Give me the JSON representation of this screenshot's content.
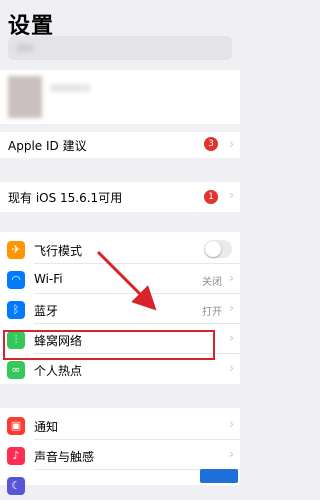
{
  "header": {
    "title": "设置"
  },
  "profile": {},
  "apple_id": {
    "label": "Apple ID 建议",
    "badge": "3"
  },
  "update": {
    "label": "现有 iOS 15.6.1可用",
    "badge": "1"
  },
  "connectivity": [
    {
      "label": "飞行模式",
      "icon": "airplane-icon",
      "color": "#ff9500",
      "value": "",
      "type": "toggle"
    },
    {
      "label": "Wi-Fi",
      "icon": "wifi-icon",
      "color": "#007aff",
      "value": "关闭",
      "type": "nav"
    },
    {
      "label": "蓝牙",
      "icon": "bluetooth-icon",
      "color": "#007aff",
      "value": "打开",
      "type": "nav"
    },
    {
      "label": "蜂窝网络",
      "icon": "cellular-icon",
      "color": "#34c759",
      "value": "",
      "type": "nav"
    },
    {
      "label": "个人热点",
      "icon": "hotspot-icon",
      "color": "#34c759",
      "value": "",
      "type": "nav"
    }
  ],
  "notifications": [
    {
      "label": "通知",
      "icon": "notifications-icon",
      "color": "#ff3b30"
    },
    {
      "label": "声音与触感",
      "icon": "sound-icon",
      "color": "#ff2d55"
    }
  ],
  "annotation": {
    "highlight_color": "#d8232a"
  }
}
